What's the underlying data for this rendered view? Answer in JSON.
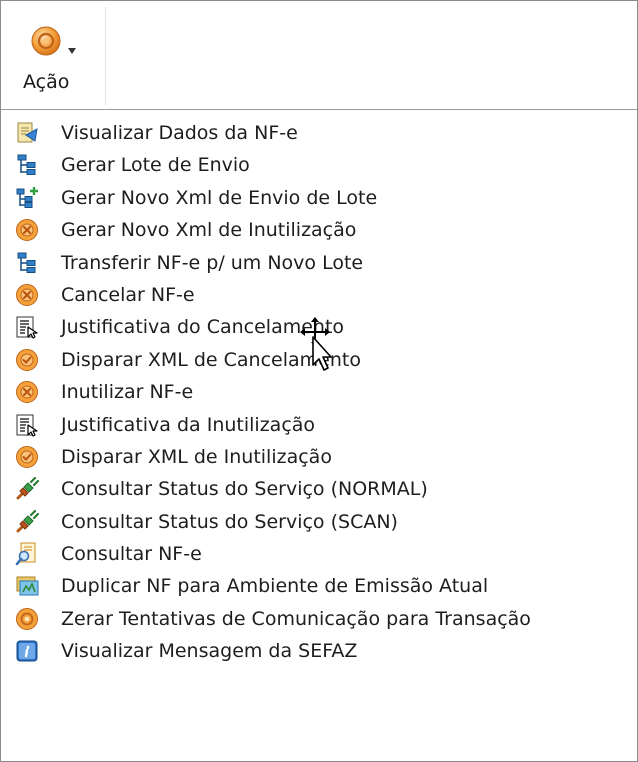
{
  "toolbar": {
    "action_label": "Ação",
    "action_icon": "orange-circle-icon"
  },
  "menu": {
    "items": [
      {
        "label": "Visualizar Dados da NF-e",
        "icon": "view-document-icon"
      },
      {
        "label": "Gerar Lote de Envio",
        "icon": "tree-icon"
      },
      {
        "label": "Gerar Novo Xml de Envio de Lote",
        "icon": "tree-add-icon"
      },
      {
        "label": "Gerar Novo Xml de Inutilização",
        "icon": "orange-cancel-icon"
      },
      {
        "label": "Transferir NF-e p/ um Novo Lote",
        "icon": "tree-icon"
      },
      {
        "label": "Cancelar NF-e",
        "icon": "orange-cancel-icon"
      },
      {
        "label": "Justificativa do Cancelamento",
        "icon": "justification-icon"
      },
      {
        "label": "Disparar XML de Cancelamento",
        "icon": "orange-check-icon"
      },
      {
        "label": "Inutilizar NF-e",
        "icon": "orange-cancel-icon"
      },
      {
        "label": "Justificativa da Inutilização",
        "icon": "justification-icon"
      },
      {
        "label": "Disparar XML de Inutilização",
        "icon": "orange-check-icon"
      },
      {
        "label": "Consultar Status do Serviço (NORMAL)",
        "icon": "plug-icon"
      },
      {
        "label": "Consultar Status do Serviço (SCAN)",
        "icon": "plug-icon"
      },
      {
        "label": "Consultar NF-e",
        "icon": "search-document-icon"
      },
      {
        "label": "Duplicar NF para Ambiente de Emissão Atual",
        "icon": "duplicate-icon"
      },
      {
        "label": "Zerar Tentativas de Comunicação para Transação",
        "icon": "orange-circle-icon"
      },
      {
        "label": "Visualizar Mensagem da SEFAZ",
        "icon": "info-icon"
      }
    ]
  },
  "colors": {
    "orange": "#f08a24",
    "orange_light": "#fbc27a",
    "tree_blue": "#1f6fb5",
    "green": "#3aa14a",
    "brown": "#b35a1a"
  }
}
